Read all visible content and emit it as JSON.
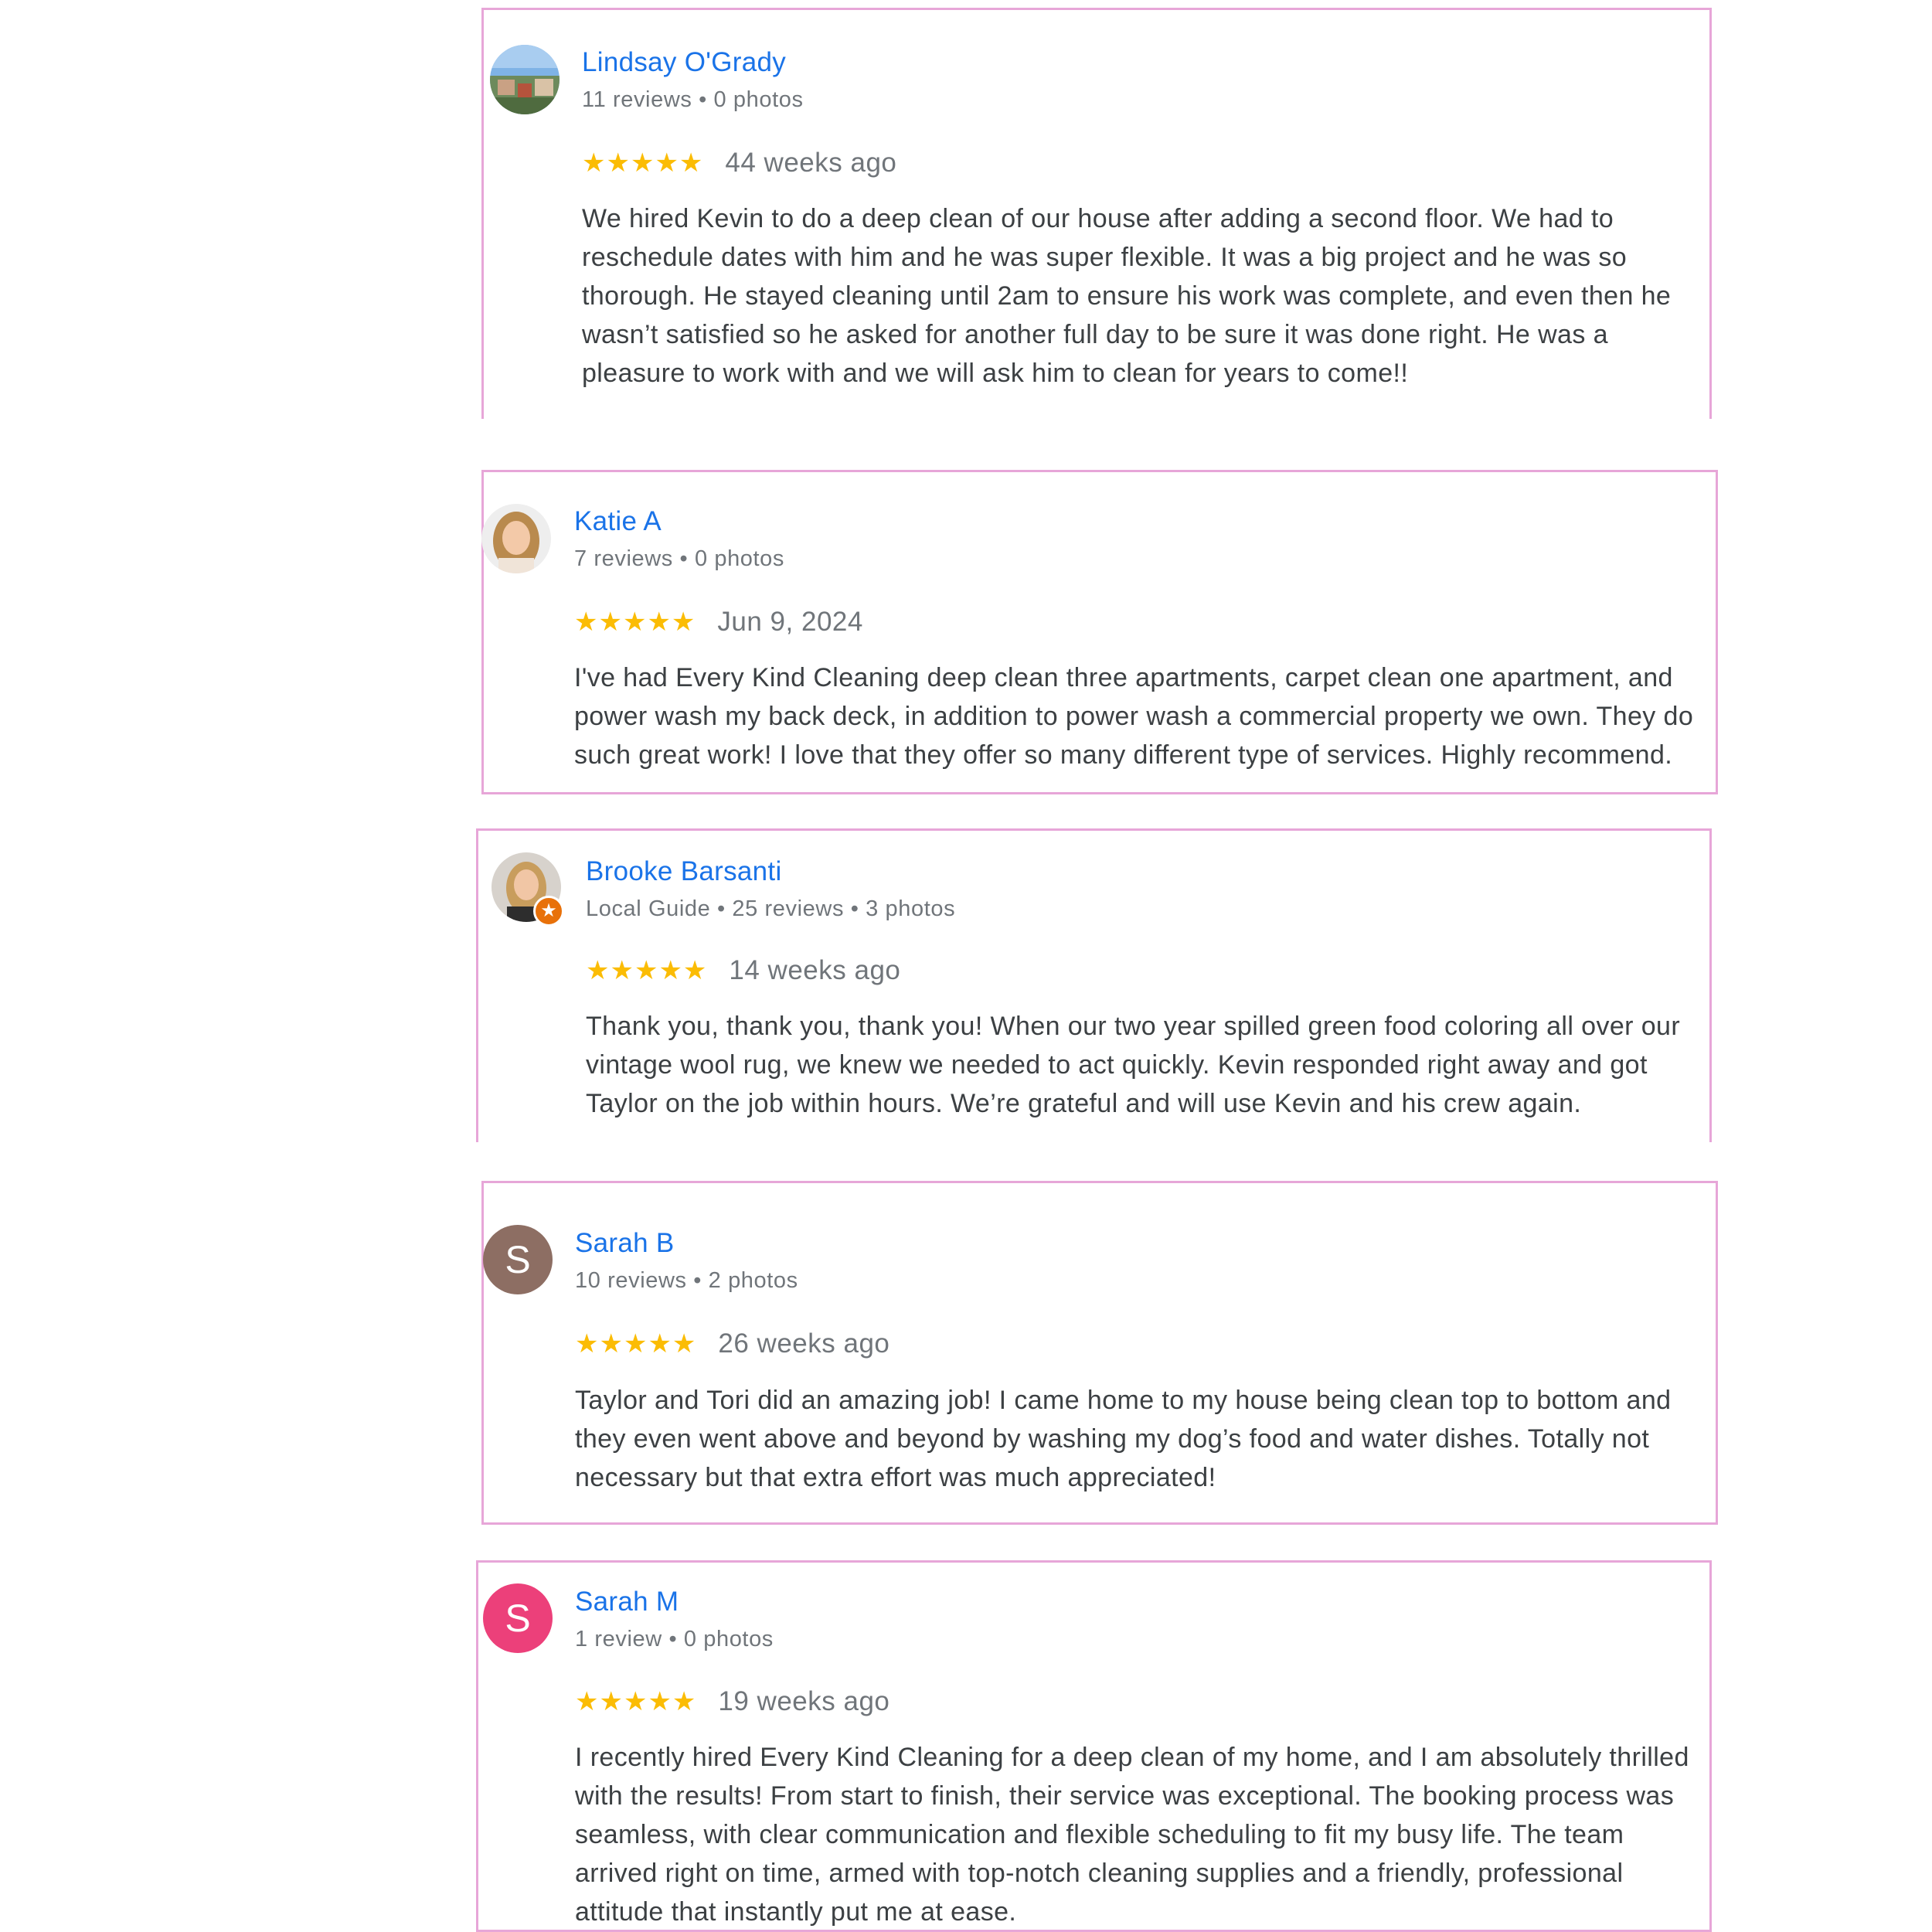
{
  "reviews": [
    {
      "name": "Lindsay O'Grady",
      "meta": "11 reviews • 0 photos",
      "stars": "★★★★★",
      "rating": 5,
      "date": "44 weeks ago",
      "text": "We hired Kevin to do a deep clean of our house after adding a second floor. We had to reschedule dates with him and he was super flexible. It was a big project and he was so thorough. He stayed cleaning until 2am to ensure his work was complete, and even then he wasn’t satisfied so he asked for another full day to be sure it was done right. He was a pleasure to work with and we will ask him to clean for years to come!!",
      "avatar": "photo-avatar"
    },
    {
      "name": "Katie A",
      "meta": "7 reviews • 0 photos",
      "stars": "★★★★★",
      "rating": 5,
      "date": "Jun 9, 2024",
      "text": "I've had Every Kind Cleaning deep clean three apartments, carpet clean one apartment, and power wash my back deck, in addition to power wash a commercial property we own. They do such great work! I love that they offer so many different type of services. Highly recommend.",
      "avatar": "photo-avatar"
    },
    {
      "name": "Brooke Barsanti",
      "meta": "Local Guide • 25 reviews • 3 photos",
      "stars": "★★★★★",
      "rating": 5,
      "date": "14 weeks ago",
      "text": "Thank you, thank you, thank you! When our two year spilled green food coloring all over our vintage wool rug, we knew we needed to act quickly. Kevin responded right away and got Taylor on the job within hours. We’re grateful and will use Kevin and his crew again.",
      "avatar": "photo-avatar",
      "badge_icon": "local-guide-star-icon",
      "badge_glyph": "★",
      "badge_color": "#e8710a"
    },
    {
      "name": "Sarah B",
      "meta": "10 reviews • 2 photos",
      "stars": "★★★★★",
      "rating": 5,
      "date": "26 weeks ago",
      "text": "Taylor and Tori did an amazing job! I came home to my house being clean top to bottom and they even went above and beyond by washing my dog’s food and water dishes. Totally not necessary but that extra effort was much appreciated!",
      "avatar_letter": "S",
      "avatar_color": "#8d6e63"
    },
    {
      "name": "Sarah M",
      "meta": "1 review • 0 photos",
      "stars": "★★★★★",
      "rating": 5,
      "date": "19 weeks ago",
      "text": "I recently hired Every Kind Cleaning for a deep clean of my home, and I am absolutely thrilled with the results! From start to finish, their service was exceptional. The booking process was seamless, with clear communication and flexible scheduling to fit my busy life. The team arrived right on time, armed with top-notch cleaning supplies and a friendly, professional attitude that instantly put me at ease.",
      "avatar_letter": "S",
      "avatar_color": "#ec407a"
    }
  ],
  "colors": {
    "name_link": "#1a73e8",
    "star": "#fbbc04",
    "card_border": "#e7a6d8",
    "meta_text": "#70757a",
    "body_text": "#3c4043"
  }
}
